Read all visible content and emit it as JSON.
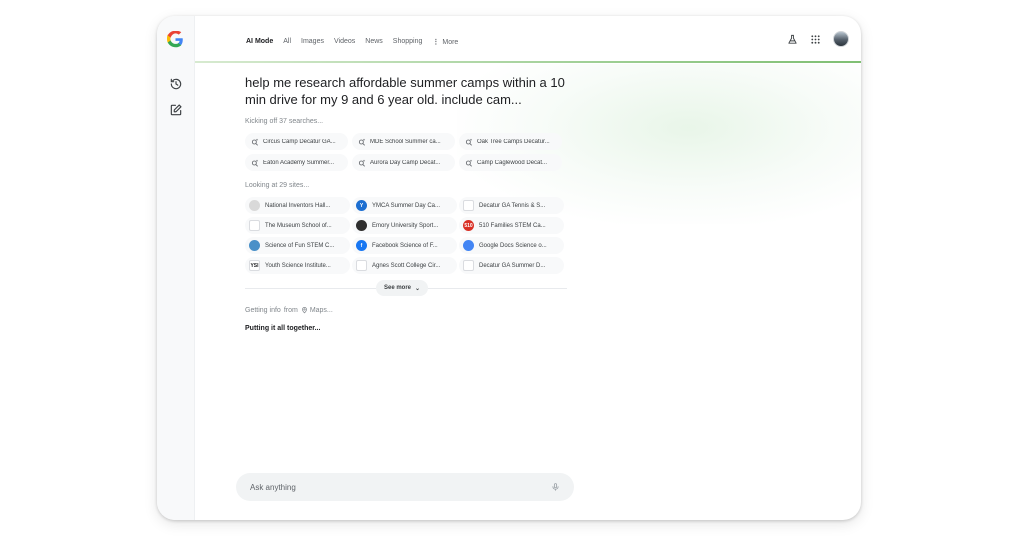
{
  "nav": {
    "tabs": [
      "AI Mode",
      "All",
      "Images",
      "Videos",
      "News",
      "Shopping"
    ],
    "more_label": "More"
  },
  "query": "help me research affordable summer camps within a 10 min drive for my 9 and 6 year old. include cam...",
  "search_status": "Kicking off 37 searches...",
  "searches": [
    "Circus Camp Decatur GA...",
    "MDE School Summer ca...",
    "Oak Tree Camps Decatur...",
    "Eaton Academy Summer...",
    "Aurora Day Camp Decat...",
    "Camp Caglewood Decat..."
  ],
  "sites_status": "Looking at 29 sites...",
  "sites": [
    {
      "label": "National Inventors Hall...",
      "icon": "inventors-hall-favicon",
      "color": "#d9d9d9",
      "glyph": ""
    },
    {
      "label": "YMCA Summer Day Ca...",
      "icon": "ymca-favicon",
      "color": "#1d6fd1",
      "glyph": "Y"
    },
    {
      "label": "Decatur GA  Tennis & S...",
      "icon": "decatur-favicon",
      "color": "#ffffff",
      "glyph": ""
    },
    {
      "label": "The Museum School  of...",
      "icon": "museum-school-favicon",
      "color": "#ffffff",
      "glyph": ""
    },
    {
      "label": "Emory University  Sport...",
      "icon": "emory-favicon",
      "color": "#2f2f2f",
      "glyph": ""
    },
    {
      "label": "510 Families  STEM Ca...",
      "icon": "510-families-favicon",
      "color": "#d93025",
      "glyph": "510"
    },
    {
      "label": "Science of Fun  STEM C...",
      "icon": "science-of-fun-favicon",
      "color": "#4a90c8",
      "glyph": ""
    },
    {
      "label": "Facebook  Science of F...",
      "icon": "facebook-favicon",
      "color": "#1877f2",
      "glyph": "f"
    },
    {
      "label": "Google Docs  Science o...",
      "icon": "google-docs-favicon",
      "color": "#4285f4",
      "glyph": ""
    },
    {
      "label": "Youth Science Institute...",
      "icon": "ysi-favicon",
      "color": "#ffffff",
      "glyph": "YSI"
    },
    {
      "label": "Agnes Scott College  Cir...",
      "icon": "agnes-scott-favicon",
      "color": "#ffffff",
      "glyph": ""
    },
    {
      "label": "Decatur GA  Summer D...",
      "icon": "decatur-favicon",
      "color": "#ffffff",
      "glyph": ""
    }
  ],
  "see_more": "See more",
  "info_line": {
    "prefix": "Getting info",
    "from": "from",
    "source": "Maps..."
  },
  "putting_together": "Putting it all together...",
  "ask": {
    "placeholder": "Ask anything"
  },
  "colors": {
    "accent_line": "#7fbf73",
    "chip_bg": "#f8f9fa",
    "ask_bg": "#f1f3f4"
  }
}
